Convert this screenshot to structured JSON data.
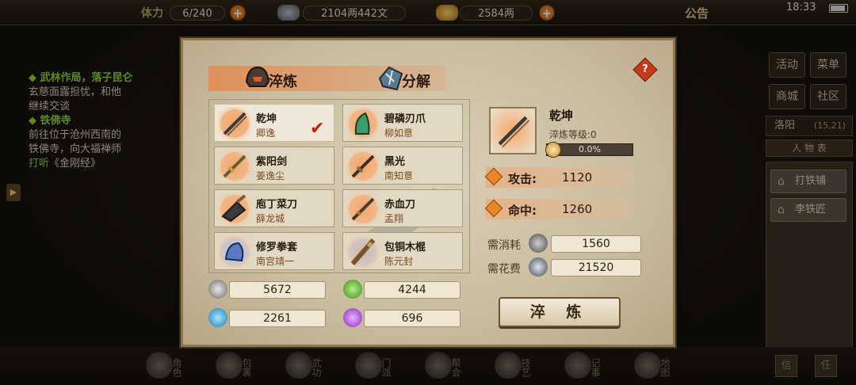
{
  "topbar": {
    "stamina_label": "体力",
    "stamina_value": "6/240",
    "silver_value": "2104两442文",
    "gold_value": "2584两",
    "notice_label": "公告",
    "clock": "18:33"
  },
  "quest_log": [
    {
      "title": "武林作局，落子昆仑",
      "lines": [
        "玄慈面露担忧，和他",
        "继续交谈"
      ]
    },
    {
      "title": "铁佛寺",
      "lines": [
        "前往位于沧州西南的",
        "铁佛寺，向大福禅师"
      ],
      "highlight_prefix": "打听",
      "highlight_text": "《金刚经》"
    }
  ],
  "right_menu": {
    "buttons": [
      "活动",
      "菜单",
      "商城",
      "社区"
    ],
    "location_name": "洛阳",
    "location_coords": "(15,21)",
    "tab_label": "人 物 表",
    "npcs": [
      "打铁铺",
      "李铁匠"
    ]
  },
  "bottom_nav": [
    "角色",
    "包裹",
    "武功",
    "门派",
    "帮会",
    "技艺",
    "记事",
    "地图"
  ],
  "bottom_right": [
    "信",
    "任"
  ],
  "dialog": {
    "tabs": [
      {
        "label": "淬炼",
        "active": true
      },
      {
        "label": "分解",
        "active": false
      }
    ],
    "help_label": "?",
    "items": [
      {
        "name": "乾坤",
        "owner": "卿逸",
        "selected": true
      },
      {
        "name": "碧磷刃爪",
        "owner": "柳如意",
        "selected": false
      },
      {
        "name": "紫阳剑",
        "owner": "姜逸尘",
        "selected": false
      },
      {
        "name": "黑光",
        "owner": "南知意",
        "selected": false
      },
      {
        "name": "庖丁菜刀",
        "owner": "薛龙城",
        "selected": false
      },
      {
        "name": "赤血刀",
        "owner": "孟翔",
        "selected": false
      },
      {
        "name": "修罗拳套",
        "owner": "南宫靖一",
        "selected": false
      },
      {
        "name": "包铜木棍",
        "owner": "陈元封",
        "selected": false
      }
    ],
    "selected_check": "✔",
    "resources": [
      {
        "icon": "silver-ore-icon",
        "color": "#9a9a9a",
        "value": "5672"
      },
      {
        "icon": "green-gem-icon",
        "color": "#5ab83a",
        "value": "4244"
      },
      {
        "icon": "blue-gem-icon",
        "color": "#3aa6d8",
        "value": "2261"
      },
      {
        "icon": "purple-gem-icon",
        "color": "#b45ad8",
        "value": "696"
      }
    ],
    "detail": {
      "name": "乾坤",
      "level_text": "淬炼等级:0",
      "progress_text": "0.0%",
      "progress": 0.0,
      "attrs": [
        {
          "label": "攻击:",
          "value": "1120"
        },
        {
          "label": "命中:",
          "value": "1260"
        }
      ],
      "costs": [
        {
          "label": "需消耗",
          "value": "1560"
        },
        {
          "label": "需花费",
          "value": "21520"
        }
      ]
    },
    "refine_button": "淬 炼"
  }
}
